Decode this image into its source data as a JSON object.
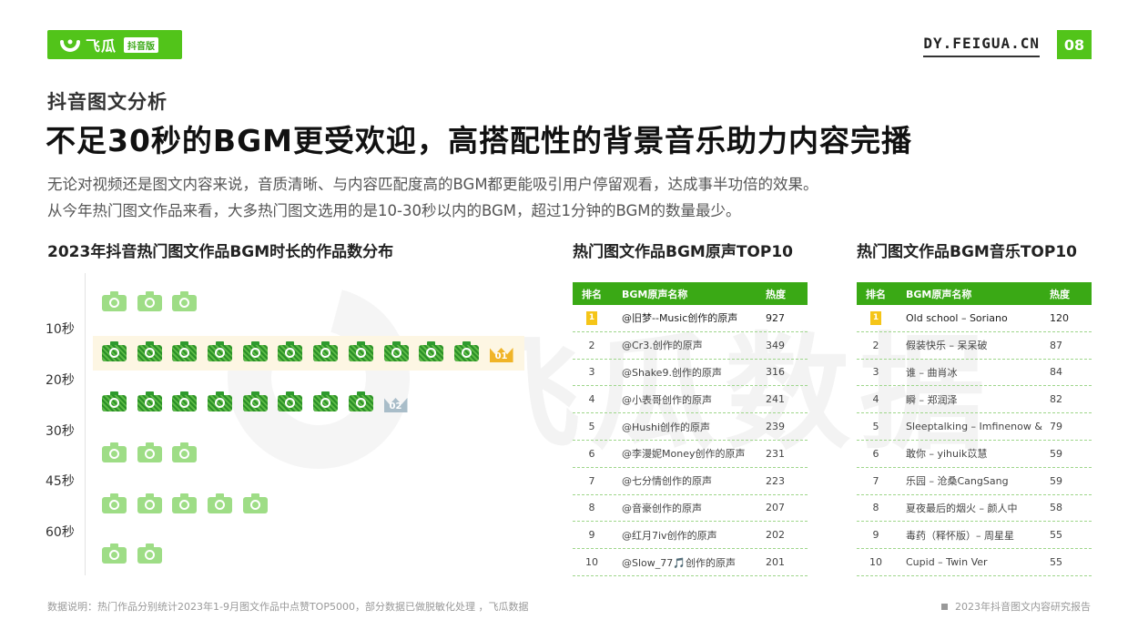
{
  "brand": {
    "logo_text": "飞瓜",
    "logo_tag": "抖音版",
    "site": "DY.FEIGUA.CN",
    "page_number": "08",
    "accent_color": "#52c41a",
    "watermark_text": "飞瓜数据"
  },
  "section_title": "抖音图文分析",
  "headline": "不足30秒的BGM更受欢迎，高搭配性的背景音乐助力内容完播",
  "description": [
    "无论对视频还是图文内容来说，音质清晰、与内容匹配度高的BGM都更能吸引用户停留观看，达成事半功倍的效果。",
    "从今年热门图文作品来看，大多热门图文选用的是10-30秒以内的BGM，超过1分钟的BGM的数量最少。"
  ],
  "distribution_chart": {
    "title": "2023年抖音热门图文作品BGM时长的作品数分布",
    "y_labels": [
      "10秒",
      "20秒",
      "30秒",
      "45秒",
      "60秒"
    ],
    "rows": [
      {
        "icon_count": 3,
        "style": "light",
        "highlight": false,
        "rank_badge": ""
      },
      {
        "icon_count": 11,
        "style": "dark",
        "highlight": true,
        "rank_badge": "01"
      },
      {
        "icon_count": 8,
        "style": "dark",
        "highlight": false,
        "rank_badge": "02"
      },
      {
        "icon_count": 3,
        "style": "light",
        "highlight": false,
        "rank_badge": ""
      },
      {
        "icon_count": 5,
        "style": "light",
        "highlight": false,
        "rank_badge": ""
      },
      {
        "icon_count": 2,
        "style": "light",
        "highlight": false,
        "rank_badge": ""
      }
    ]
  },
  "table_original": {
    "title": "热门图文作品BGM原声TOP10",
    "headers": [
      "排名",
      "BGM原声名称",
      "热度"
    ],
    "rows": [
      {
        "rank": "1",
        "name": "@旧梦--Music创作的原声",
        "heat": "927"
      },
      {
        "rank": "2",
        "name": "@Cr3.创作的原声",
        "heat": "349"
      },
      {
        "rank": "3",
        "name": "@Shake9.创作的原声",
        "heat": "316"
      },
      {
        "rank": "4",
        "name": "@小表哥创作的原声",
        "heat": "241"
      },
      {
        "rank": "5",
        "name": "@Hushi创作的原声",
        "heat": "239"
      },
      {
        "rank": "6",
        "name": "@李漫妮Money创作的原声",
        "heat": "231"
      },
      {
        "rank": "7",
        "name": "@七分情创作的原声",
        "heat": "223"
      },
      {
        "rank": "8",
        "name": "@音豪创作的原声",
        "heat": "207"
      },
      {
        "rank": "9",
        "name": "@红月7iv创作的原声",
        "heat": "202"
      },
      {
        "rank": "10",
        "name": "@Slow_77🎵创作的原声",
        "heat": "201"
      }
    ]
  },
  "table_music": {
    "title": "热门图文作品BGM音乐TOP10",
    "headers": [
      "排名",
      "BGM原声名称",
      "热度"
    ],
    "rows": [
      {
        "rank": "1",
        "name": "Old school – Soriano",
        "heat": "120"
      },
      {
        "rank": "2",
        "name": "假装快乐 – 呆呆破",
        "heat": "87"
      },
      {
        "rank": "3",
        "name": "谁 – 曲肖冰",
        "heat": "84"
      },
      {
        "rank": "4",
        "name": "瞬 – 郑润泽",
        "heat": "82"
      },
      {
        "rank": "5",
        "name": "Sleeptalking – Imfinenow & ÉMIA",
        "heat": "79"
      },
      {
        "rank": "6",
        "name": "敢你 – yihuik苡慧",
        "heat": "59"
      },
      {
        "rank": "7",
        "name": "乐园 – 沧桑CangSang",
        "heat": "59"
      },
      {
        "rank": "8",
        "name": "夏夜最后的烟火 – 颜人中",
        "heat": "58"
      },
      {
        "rank": "9",
        "name": "毒药（释怀版）– 周星星",
        "heat": "55"
      },
      {
        "rank": "10",
        "name": "Cupid – Twin Ver",
        "heat": "55"
      }
    ]
  },
  "footer": {
    "note": "数据说明：热门作品分别统计2023年1-9月图文作品中点赞TOP5000，部分数据已做脱敏化处理 ，飞瓜数据",
    "report": "2023年抖音图文内容研究报告"
  }
}
